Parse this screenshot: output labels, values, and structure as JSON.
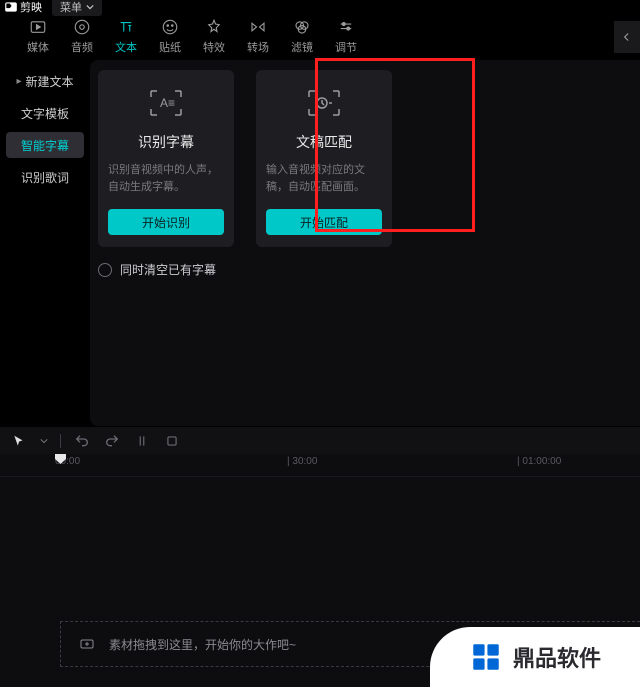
{
  "titlebar": {
    "app_name": "剪映",
    "menu_label": "菜单"
  },
  "tabs": {
    "t0": "媒体",
    "t1": "音频",
    "t2": "文本",
    "t3": "贴纸",
    "t4": "特效",
    "t5": "转场",
    "t6": "滤镜",
    "t7": "调节"
  },
  "sidebar": {
    "s0": "新建文本",
    "s1": "文字模板",
    "s2": "智能字幕",
    "s3": "识别歌词"
  },
  "cards": {
    "c1": {
      "title": "识别字幕",
      "desc": "识别音视频中的人声，自动生成字幕。",
      "btn": "开始识别"
    },
    "c2": {
      "title": "文稿匹配",
      "desc": "输入音视频对应的文稿，自动匹配画面。",
      "btn": "开始匹配"
    }
  },
  "checkbox": {
    "label": "同时清空已有字幕"
  },
  "ruler": {
    "m0": "00:00",
    "m1": "| 30:00",
    "m2": "| 01:00:00"
  },
  "track": {
    "placeholder": "素材拖拽到这里，开始你的大作吧~"
  },
  "watermark": {
    "text": "鼎品软件"
  }
}
